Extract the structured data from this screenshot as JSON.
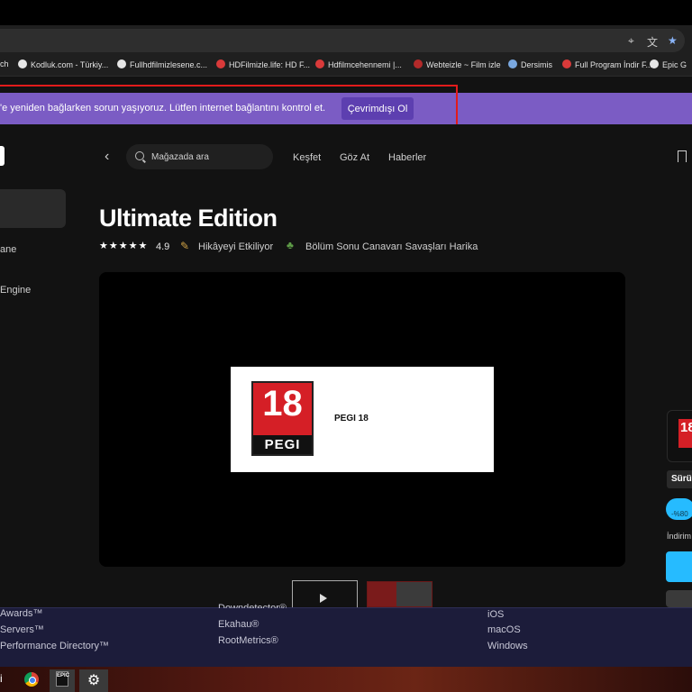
{
  "browser": {
    "bookmarks": [
      {
        "label": "ch",
        "icon_color": ""
      },
      {
        "label": "Kodluk.com - Türkiy...",
        "icon_color": "#e6e6e6"
      },
      {
        "label": "Fullhdfilmizlesene.c...",
        "icon_color": "#e6e6e6"
      },
      {
        "label": "HDFilmizle.life: HD F...",
        "icon_color": "#d93a3a"
      },
      {
        "label": "Hdfilmcehennemi |...",
        "icon_color": "#d93a3a"
      },
      {
        "label": "Webteizle ~ Film izle",
        "icon_color": "#b32a2a"
      },
      {
        "label": "Dersimis",
        "icon_color": "#7aa8e0"
      },
      {
        "label": "Full Program İndir F...",
        "icon_color": "#d93a3a"
      },
      {
        "label": "Epic G",
        "icon_color": "#e6e6e6"
      }
    ],
    "icons": {
      "location": "location-pin-icon",
      "translate": "translate-icon",
      "star": "star-icon"
    }
  },
  "banner": {
    "message": "'e yeniden bağlarken sorun yaşıyoruz. Lütfen internet bağlantını kontrol et.",
    "button_label": "Çevrimdışı Ol",
    "color": "#7b5cc4"
  },
  "store_nav": {
    "search_placeholder": "Mağazada ara",
    "links": [
      "Keşfet",
      "Göz At",
      "Haberler"
    ]
  },
  "sidebar": {
    "items": [
      "ane",
      "Engine"
    ]
  },
  "product": {
    "title": "Ultimate Edition",
    "stars": "★★★★★",
    "rating": "4.9",
    "tags": [
      "Hikâyeyi Etkiliyor",
      "Bölüm Sonu Canavarı Savaşları Harika"
    ],
    "pegi_number": "18",
    "pegi_word": "PEGI",
    "pegi_label": "PEGI 18"
  },
  "right_column": {
    "pegi_number": "18",
    "version_label": "Sürü",
    "discount": "-%80",
    "discount_label": "İndirim"
  },
  "footer": {
    "col1": [
      "Awards™",
      "Servers™",
      "Performance Directory™"
    ],
    "col2": [
      "Downdetector®",
      "Ekahau®",
      "RootMetrics®"
    ],
    "col3": [
      "iOS",
      "macOS",
      "Windows"
    ]
  },
  "taskbar": {
    "edge_glyph": "i",
    "epic_label": "EPIC"
  },
  "colors": {
    "accent": "#26bbff",
    "pegi_red": "#d51f26",
    "highlight": "#e21b1b"
  }
}
